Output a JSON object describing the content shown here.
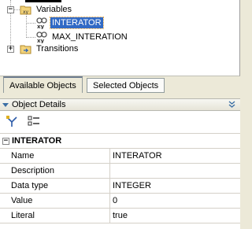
{
  "tree": {
    "nodes": [
      {
        "label": "Variables",
        "icon": "folder-variables-icon",
        "expander": "−"
      },
      {
        "label": "INTERATOR",
        "icon": "variable-xy-icon",
        "selected": true
      },
      {
        "label": "MAX_INTERATION",
        "icon": "variable-xy-icon"
      },
      {
        "label": "Transitions",
        "icon": "folder-transitions-icon",
        "expander": "+"
      }
    ]
  },
  "tabs": [
    {
      "label": "Available Objects",
      "active": true
    },
    {
      "label": "Selected Objects",
      "active": false
    }
  ],
  "details": {
    "title": "Object Details",
    "toolbar": [
      {
        "icon": "categorized-view-icon"
      },
      {
        "icon": "alphabetical-view-icon"
      }
    ],
    "category": {
      "label": "INTERATOR",
      "expander": "−"
    },
    "properties": [
      {
        "name": "Name",
        "value": "INTERATOR"
      },
      {
        "name": "Description",
        "value": ""
      },
      {
        "name": "Data type",
        "value": "INTEGER"
      },
      {
        "name": "Value",
        "value": "0"
      },
      {
        "name": "Literal",
        "value": "true"
      }
    ]
  },
  "colors": {
    "selection": "#316ac5",
    "panel": "#ece9d8",
    "header_arrow": "#3a6ea5"
  }
}
